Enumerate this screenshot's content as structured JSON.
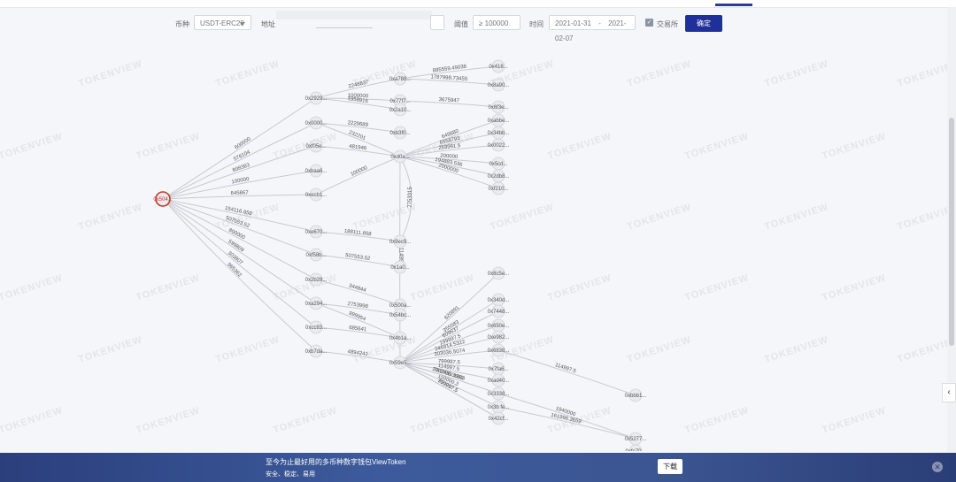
{
  "filters": {
    "currency_label": "币种",
    "currency_value": "USDT-ERC20",
    "address_label": "地址",
    "address_value": "",
    "threshold_label": "阈值",
    "threshold_value": "≥ 100000",
    "time_label": "时间",
    "date_from": "2021-01-31",
    "date_sep": "-",
    "date_to": "2021-02-07",
    "exchange_label": "交易所",
    "exchange_checked": true,
    "confirm_label": "确定"
  },
  "watermark": "TOKENVIEW",
  "graph": {
    "nodes": [
      {
        "id": "root",
        "label": "0x504..."
      },
      {
        "id": "a1",
        "label": "0x2929..."
      },
      {
        "id": "a2",
        "label": "0x0000..."
      },
      {
        "id": "a3",
        "label": "0xf05e..."
      },
      {
        "id": "a4",
        "label": "0xbaa6..."
      },
      {
        "id": "a5",
        "label": "0xecb1..."
      },
      {
        "id": "a6",
        "label": "0xe670..."
      },
      {
        "id": "a7",
        "label": "0xf58b..."
      },
      {
        "id": "a8",
        "label": "0x2b28..."
      },
      {
        "id": "a9",
        "label": "0xa294..."
      },
      {
        "id": "a10",
        "label": "0xcc83..."
      },
      {
        "id": "a11",
        "label": "0xb7da..."
      },
      {
        "id": "b1",
        "label": "0xa788..."
      },
      {
        "id": "b2",
        "label": "0x77f7..."
      },
      {
        "id": "b3",
        "label": "0x2a10..."
      },
      {
        "id": "b4",
        "label": "0xb3f0..."
      },
      {
        "id": "b5",
        "label": "0xd0a..."
      },
      {
        "id": "b6",
        "label": "0x9ec9..."
      },
      {
        "id": "b7",
        "label": "0x1a0..."
      },
      {
        "id": "b8",
        "label": "0x500a..."
      },
      {
        "id": "b9",
        "label": "0x54bc..."
      },
      {
        "id": "b10",
        "label": "0x4b1a..."
      },
      {
        "id": "b11",
        "label": "0x59e5..."
      },
      {
        "id": "c1",
        "label": "0x418..."
      },
      {
        "id": "c2",
        "label": "0x8a90..."
      },
      {
        "id": "c3",
        "label": "0x6f3e..."
      },
      {
        "id": "c4",
        "label": "0xabbe..."
      },
      {
        "id": "c5",
        "label": "0x34bb..."
      },
      {
        "id": "c6",
        "label": "0x0022..."
      },
      {
        "id": "c7",
        "label": "0x5cd..."
      },
      {
        "id": "c8",
        "label": "0x2db8..."
      },
      {
        "id": "c9",
        "label": "0xf210..."
      },
      {
        "id": "c10",
        "label": "0x8c5e..."
      },
      {
        "id": "c11",
        "label": "0x340d..."
      },
      {
        "id": "c12",
        "label": "0x7448..."
      },
      {
        "id": "c13",
        "label": "0x650e..."
      },
      {
        "id": "c14",
        "label": "0xe982..."
      },
      {
        "id": "c15",
        "label": "0x6838..."
      },
      {
        "id": "c16",
        "label": "0x7fa6..."
      },
      {
        "id": "c17",
        "label": "0xad40..."
      },
      {
        "id": "c18",
        "label": "0x3338..."
      },
      {
        "id": "c19",
        "label": "0x3b fe..."
      },
      {
        "id": "c20",
        "label": "0x42cf..."
      },
      {
        "id": "d1",
        "label": "0xbbb1..."
      },
      {
        "id": "d2",
        "label": "0x5277..."
      },
      {
        "id": "d3",
        "label": "0xfe70..."
      }
    ],
    "edge_labels": [
      {
        "edge": "root-a1",
        "value": "600000"
      },
      {
        "edge": "root-a2",
        "value": "576104"
      },
      {
        "edge": "root-a3",
        "value": "808383"
      },
      {
        "edge": "root-a4",
        "value": "100000"
      },
      {
        "edge": "root-a5",
        "value": "645867"
      },
      {
        "edge": "root-a6",
        "value": "154116.858"
      },
      {
        "edge": "root-a7",
        "value": "507553.52"
      },
      {
        "edge": "root-a8",
        "value": "800000"
      },
      {
        "edge": "root-a9",
        "value": "599809"
      },
      {
        "edge": "root-a10",
        "value": "303807"
      },
      {
        "edge": "root-a11",
        "value": "965362"
      },
      {
        "edge": "a1-b1",
        "value": "2248837"
      },
      {
        "edge": "a1-b2",
        "value": "1000000"
      },
      {
        "edge": "a1-b3",
        "value": "1958916"
      },
      {
        "edge": "a2-b4",
        "value": "2229689"
      },
      {
        "edge": "a2-b5",
        "value": "232201"
      },
      {
        "edge": "a3-b5",
        "value": "481946"
      },
      {
        "edge": "a5-b5",
        "value": "100000"
      },
      {
        "edge": "a6-b6",
        "value": "188111.858"
      },
      {
        "edge": "a7-b7",
        "value": "507553.52"
      },
      {
        "edge": "a8-b8",
        "value": "344844"
      },
      {
        "edge": "a9-b10",
        "value": "999954"
      },
      {
        "edge": "a9-b9",
        "value": "2753998"
      },
      {
        "edge": "a10-b10",
        "value": "685641"
      },
      {
        "edge": "a11-b11",
        "value": "4894241"
      },
      {
        "edge": "b1-c1",
        "value": "885559.49038"
      },
      {
        "edge": "b1-c2",
        "value": "1787998.73455"
      },
      {
        "edge": "b2-c3",
        "value": "3675947"
      },
      {
        "edge": "b5-c4",
        "value": "649880"
      },
      {
        "edge": "b5-c5",
        "value": "6558793"
      },
      {
        "edge": "b5-c6",
        "value": "253991.5"
      },
      {
        "edge": "b5-c7",
        "value": "200000"
      },
      {
        "edge": "b5-c8",
        "value": "194883.536"
      },
      {
        "edge": "b5-c9",
        "value": "2000000"
      },
      {
        "edge": "b5-b11",
        "value": "1149962"
      },
      {
        "edge": "b6-b5",
        "value": "7753315"
      },
      {
        "edge": "b11-c10",
        "value": "620891"
      },
      {
        "edge": "b11-c11",
        "value": "355583"
      },
      {
        "edge": "b11-c12",
        "value": "609637"
      },
      {
        "edge": "b11-c13",
        "value": "199997.5"
      },
      {
        "edge": "b11-c14",
        "value": "246914.5322"
      },
      {
        "edge": "b11-c15",
        "value": "303036.5074"
      },
      {
        "edge": "b11-c16",
        "value": "799997.5"
      },
      {
        "edge": "b11-c17",
        "value": "114997.5"
      },
      {
        "edge": "b11-c18",
        "value": "1062439.1883"
      },
      {
        "edge": "b11-c19",
        "value": "150000.3"
      },
      {
        "edge": "b11-c20",
        "value": "799997.5"
      },
      {
        "edge": "b11-c18b",
        "value": "761998.3659"
      },
      {
        "edge": "b11-c20b",
        "value": "399997.5"
      },
      {
        "edge": "c15-d1",
        "value": "114997.5"
      },
      {
        "edge": "c18-d2",
        "value": "1940000"
      },
      {
        "edge": "c19-d2",
        "value": "161998.3659"
      }
    ]
  },
  "banner": {
    "line1": "至今为止最好用的多币种数字钱包ViewToken",
    "line2": "安全、稳定、易用",
    "download_label": "下载",
    "close_icon": "close-icon"
  },
  "colors": {
    "accent": "#1f2f9c",
    "root_node": "#c0392b",
    "edge": "#c7cad2",
    "node_fill": "#e9ebf0"
  }
}
